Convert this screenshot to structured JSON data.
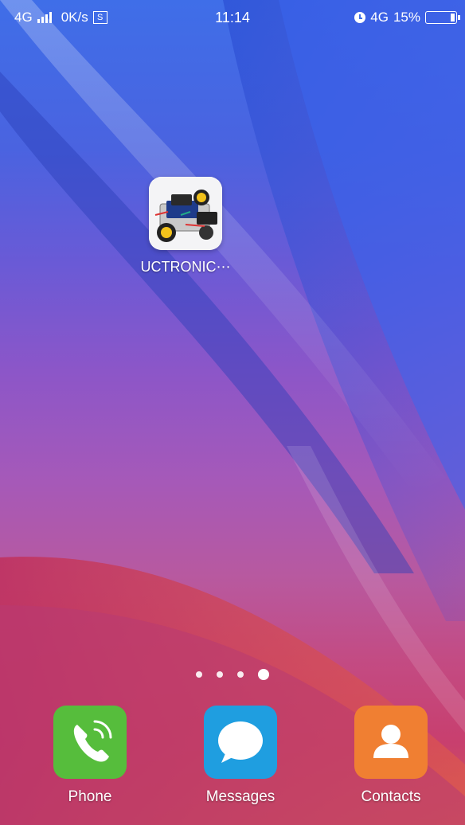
{
  "status_bar": {
    "network_left": "4G",
    "speed": "0K/s",
    "speed_icon_label": "S",
    "time": "11:14",
    "network_right": "4G",
    "battery_percent": "15%",
    "battery_level": 0.15,
    "icons": [
      "signal-icon",
      "screenshot-icon",
      "alarm-icon",
      "battery-icon"
    ]
  },
  "home": {
    "apps": [
      {
        "label": "UCTRONIC⋯",
        "icon": "robot-car-icon"
      }
    ],
    "page_indicator": {
      "pages": 4,
      "current": 4
    }
  },
  "dock": [
    {
      "label": "Phone",
      "icon": "phone-icon",
      "color": "#56bd3c"
    },
    {
      "label": "Messages",
      "icon": "messages-icon",
      "color": "#1f9ee0"
    },
    {
      "label": "Contacts",
      "icon": "contacts-icon",
      "color": "#f07f32"
    }
  ]
}
